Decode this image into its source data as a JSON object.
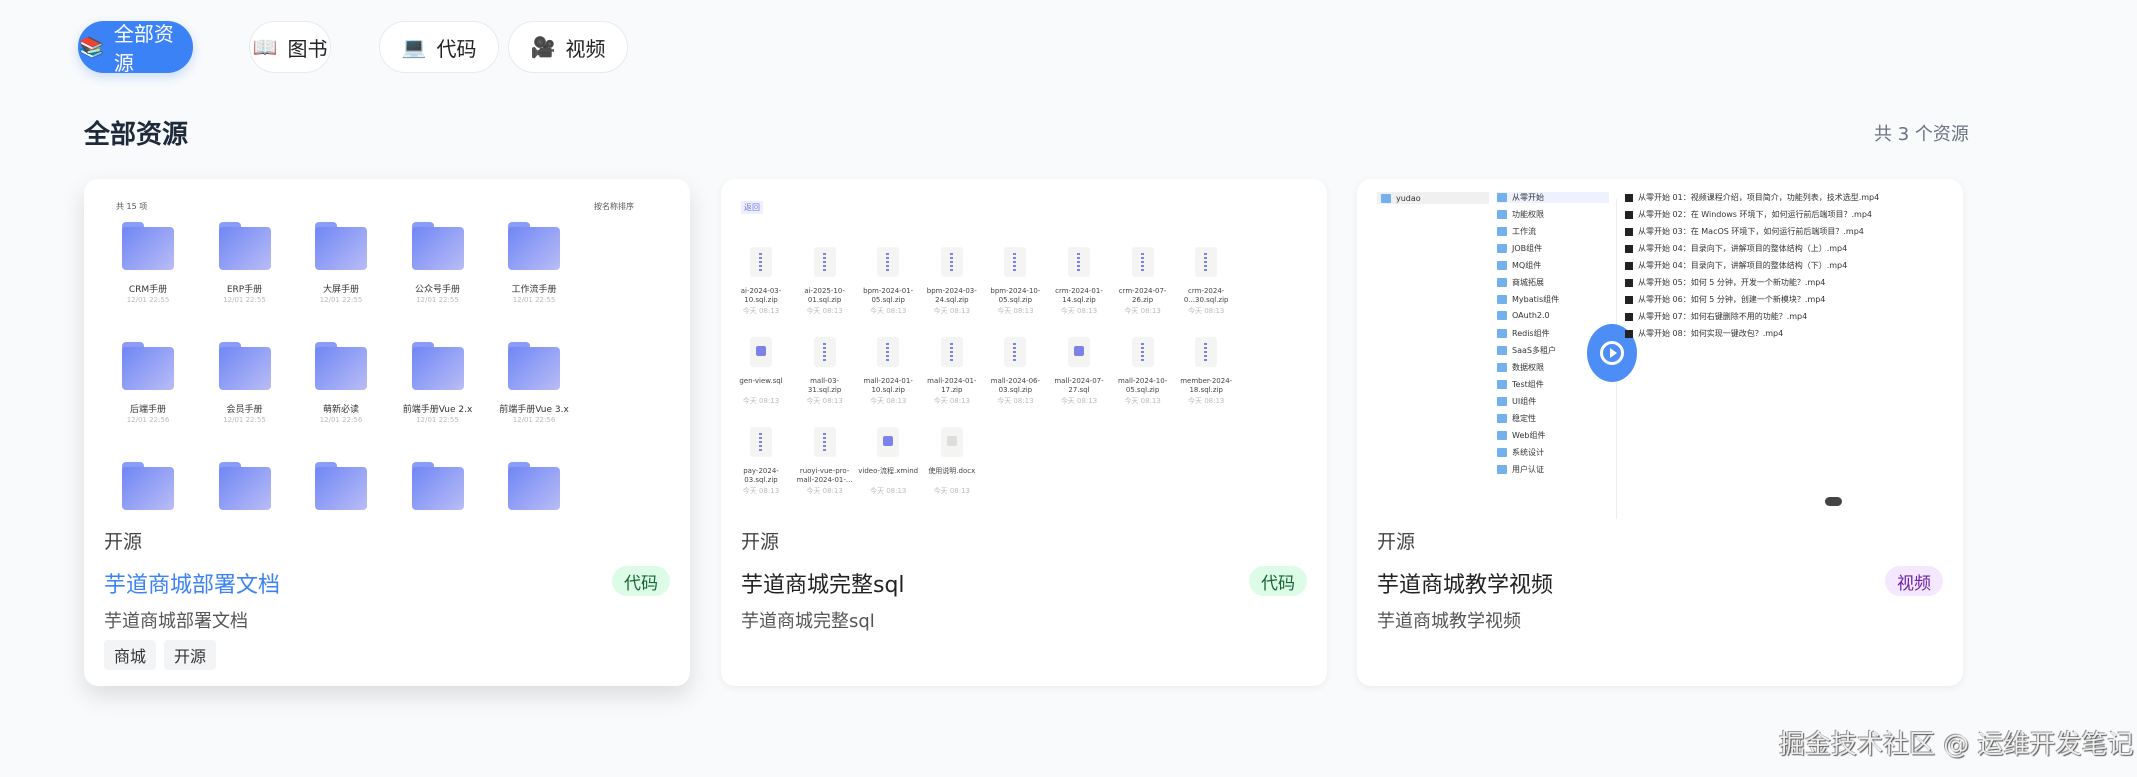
{
  "filters": [
    {
      "icon": "books-icon",
      "glyph": "📚",
      "label": "全部资源",
      "active": true
    },
    {
      "icon": "book-icon",
      "glyph": "📖",
      "label": "图书",
      "active": false
    },
    {
      "icon": "laptop-icon",
      "glyph": "💻",
      "label": "代码",
      "active": false
    },
    {
      "icon": "video-camera-icon",
      "glyph": "🎥",
      "label": "视频",
      "active": false
    }
  ],
  "section": {
    "title": "全部资源",
    "count": "共 3 个资源"
  },
  "cards": [
    {
      "source": "开源",
      "title": "芋道商城部署文档",
      "badge": "代码",
      "description": "芋道商城部署文档",
      "tags": [
        "商城",
        "开源"
      ],
      "preview": {
        "header_left": "共 15 项",
        "header_right": "按名称排序",
        "folders": [
          {
            "name": "CRM手册",
            "date": "12/01 22:55"
          },
          {
            "name": "ERP手册",
            "date": "12/01 22:55"
          },
          {
            "name": "大屏手册",
            "date": "12/01 22:55"
          },
          {
            "name": "公众号手册",
            "date": "12/01 22:55"
          },
          {
            "name": "工作流手册",
            "date": "12/01 22:55"
          },
          {
            "name": "后端手册",
            "date": "12/01 22:56"
          },
          {
            "name": "会员手册",
            "date": "12/01 22:55"
          },
          {
            "name": "萌新必读",
            "date": "12/01 22:56"
          },
          {
            "name": "前端手册Vue 2.x",
            "date": "12/01 22:55"
          },
          {
            "name": "前端手册Vue 3.x",
            "date": "12/01 22:56"
          },
          {
            "name": "",
            "date": ""
          },
          {
            "name": "",
            "date": ""
          },
          {
            "name": "",
            "date": ""
          },
          {
            "name": "",
            "date": ""
          },
          {
            "name": "",
            "date": ""
          }
        ]
      }
    },
    {
      "source": "开源",
      "title": "芋道商城完整sql",
      "badge": "代码",
      "description": "芋道商城完整sql",
      "tags": [],
      "preview": {
        "header_left": "返回",
        "files": [
          {
            "name": "ai-2024-03-10.sql.zip",
            "date": "今天 08:13",
            "type": "zip"
          },
          {
            "name": "ai-2025-10-01.sql.zip",
            "date": "今天 08:13",
            "type": "zip"
          },
          {
            "name": "bpm-2024-01-05.sql.zip",
            "date": "今天 08:13",
            "type": "zip"
          },
          {
            "name": "bpm-2024-03-24.sql.zip",
            "date": "今天 08:13",
            "type": "zip"
          },
          {
            "name": "bpm-2024-10-05.sql.zip",
            "date": "今天 08:13",
            "type": "zip"
          },
          {
            "name": "crm-2024-01-14.sql.zip",
            "date": "今天 08:13",
            "type": "zip"
          },
          {
            "name": "crm-2024-07-26.zip",
            "date": "今天 08:13",
            "type": "zip"
          },
          {
            "name": "crm-2024-0...30.sql.zip",
            "date": "今天 08:13",
            "type": "zip"
          },
          {
            "name": "gen-view.sql",
            "date": "今天 08:13",
            "type": "sql"
          },
          {
            "name": "mall-03-31.sql.zip",
            "date": "今天 08:13",
            "type": "zip"
          },
          {
            "name": "mall-2024-01-10.sql.zip",
            "date": "今天 08:13",
            "type": "zip"
          },
          {
            "name": "mall-2024-01-17.zip",
            "date": "今天 08:13",
            "type": "zip"
          },
          {
            "name": "mall-2024-06-03.sql.zip",
            "date": "今天 08:13",
            "type": "zip"
          },
          {
            "name": "mall-2024-07-27.sql",
            "date": "今天 08:13",
            "type": "sql"
          },
          {
            "name": "mall-2024-10-05.sql.zip",
            "date": "今天 08:13",
            "type": "zip"
          },
          {
            "name": "member-2024-18.sql.zip",
            "date": "今天 08:13",
            "type": "zip"
          },
          {
            "name": "pay-2024-03.sql.zip",
            "date": "今天 08:13",
            "type": "zip"
          },
          {
            "name": "ruoyi-vue-pro-mall-2024-01-...",
            "date": "今天 08:13",
            "type": "zip"
          },
          {
            "name": "video-流程.xmind",
            "date": "今天 08:13",
            "type": "xmind"
          },
          {
            "name": "使用说明.docx",
            "date": "今天 08:13",
            "type": "doc"
          }
        ]
      }
    },
    {
      "source": "开源",
      "title": "芋道商城教学视频",
      "badge": "视频",
      "description": "芋道商城教学视频",
      "tags": [],
      "preview": {
        "root": "yudao",
        "folders": [
          "从零开始",
          "功能权限",
          "工作流",
          "JOB组件",
          "MQ组件",
          "商城拓展",
          "Mybatis组件",
          "OAuth2.0",
          "Redis组件",
          "SaaS多租户",
          "数据权限",
          "Test组件",
          "UI组件",
          "稳定性",
          "Web组件",
          "系统设计",
          "用户认证"
        ],
        "videos": [
          "从零开始 01：视频课程介绍，项目简介，功能列表，技术选型.mp4",
          "从零开始 02：在 Windows 环境下，如何运行前后端项目？.mp4",
          "从零开始 03：在 MacOS 环境下，如何运行前后端项目？.mp4",
          "从零开始 04：目录向下，讲解项目的整体结构（上）.mp4",
          "从零开始 04：目录向下，讲解项目的整体结构（下）.mp4",
          "从零开始 05：如何 5 分钟，开发一个新功能？.mp4",
          "从零开始 06：如何 5 分钟，创建一个新模块？.mp4",
          "从零开始 07：如何右键删除不用的功能？.mp4",
          "从零开始 08：如何实现一键改包？.mp4"
        ]
      }
    }
  ],
  "watermark": "掘金技术社区 @ 运维开发笔记",
  "colors": {
    "accent": "#3b82f6",
    "code_badge_bg": "#dcfce7",
    "video_badge_bg": "#f3e8ff"
  }
}
